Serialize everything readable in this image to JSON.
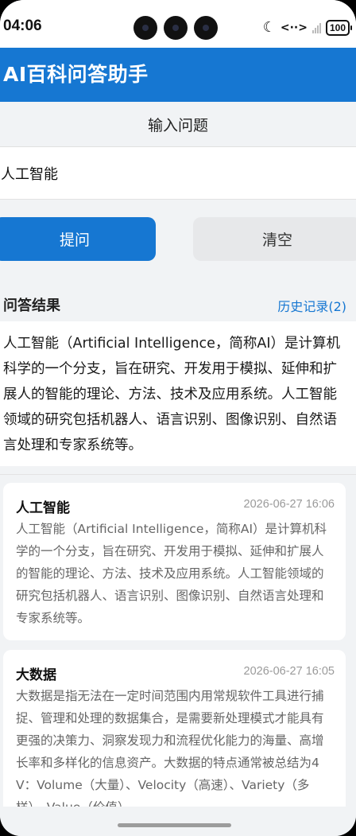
{
  "status_bar": {
    "time": "04:06",
    "battery": "100"
  },
  "app_bar": {
    "title": "AI百科问答助手"
  },
  "input": {
    "label": "输入问题",
    "value": "人工智能"
  },
  "buttons": {
    "ask": "提问",
    "clear": "清空"
  },
  "result": {
    "title": "问答结果",
    "history_link": "历史记录(2)",
    "answer": "人工智能（Artificial Intelligence，简称AI）是计算机科学的一个分支，旨在研究、开发用于模拟、延伸和扩展人的智能的理论、方法、技术及应用系统。人工智能领域的研究包括机器人、语言识别、图像识别、自然语言处理和专家系统等。"
  },
  "history": [
    {
      "question": "人工智能",
      "time": "2026-06-27 16:06",
      "answer": "人工智能（Artificial Intelligence，简称AI）是计算机科学的一个分支，旨在研究、开发用于模拟、延伸和扩展人的智能的理论、方法、技术及应用系统。人工智能领域的研究包括机器人、语言识别、图像识别、自然语言处理和专家系统等。"
    },
    {
      "question": "大数据",
      "time": "2026-06-27 16:05",
      "answer": "大数据是指无法在一定时间范围内用常规软件工具进行捕捉、管理和处理的数据集合，是需要新处理模式才能具有更强的决策力、洞察发现力和流程优化能力的海量、高增长率和多样化的信息资产。大数据的特点通常被总结为4V：Volume（大量）、Velocity（高速）、Variety（多样）、Value（价值）。"
    }
  ],
  "colors": {
    "primary": "#1677d2",
    "background": "#f1f3f5",
    "card": "#ffffff"
  },
  "icons": [
    "moon-icon",
    "sync-icon",
    "signal-icon",
    "battery-icon"
  ]
}
